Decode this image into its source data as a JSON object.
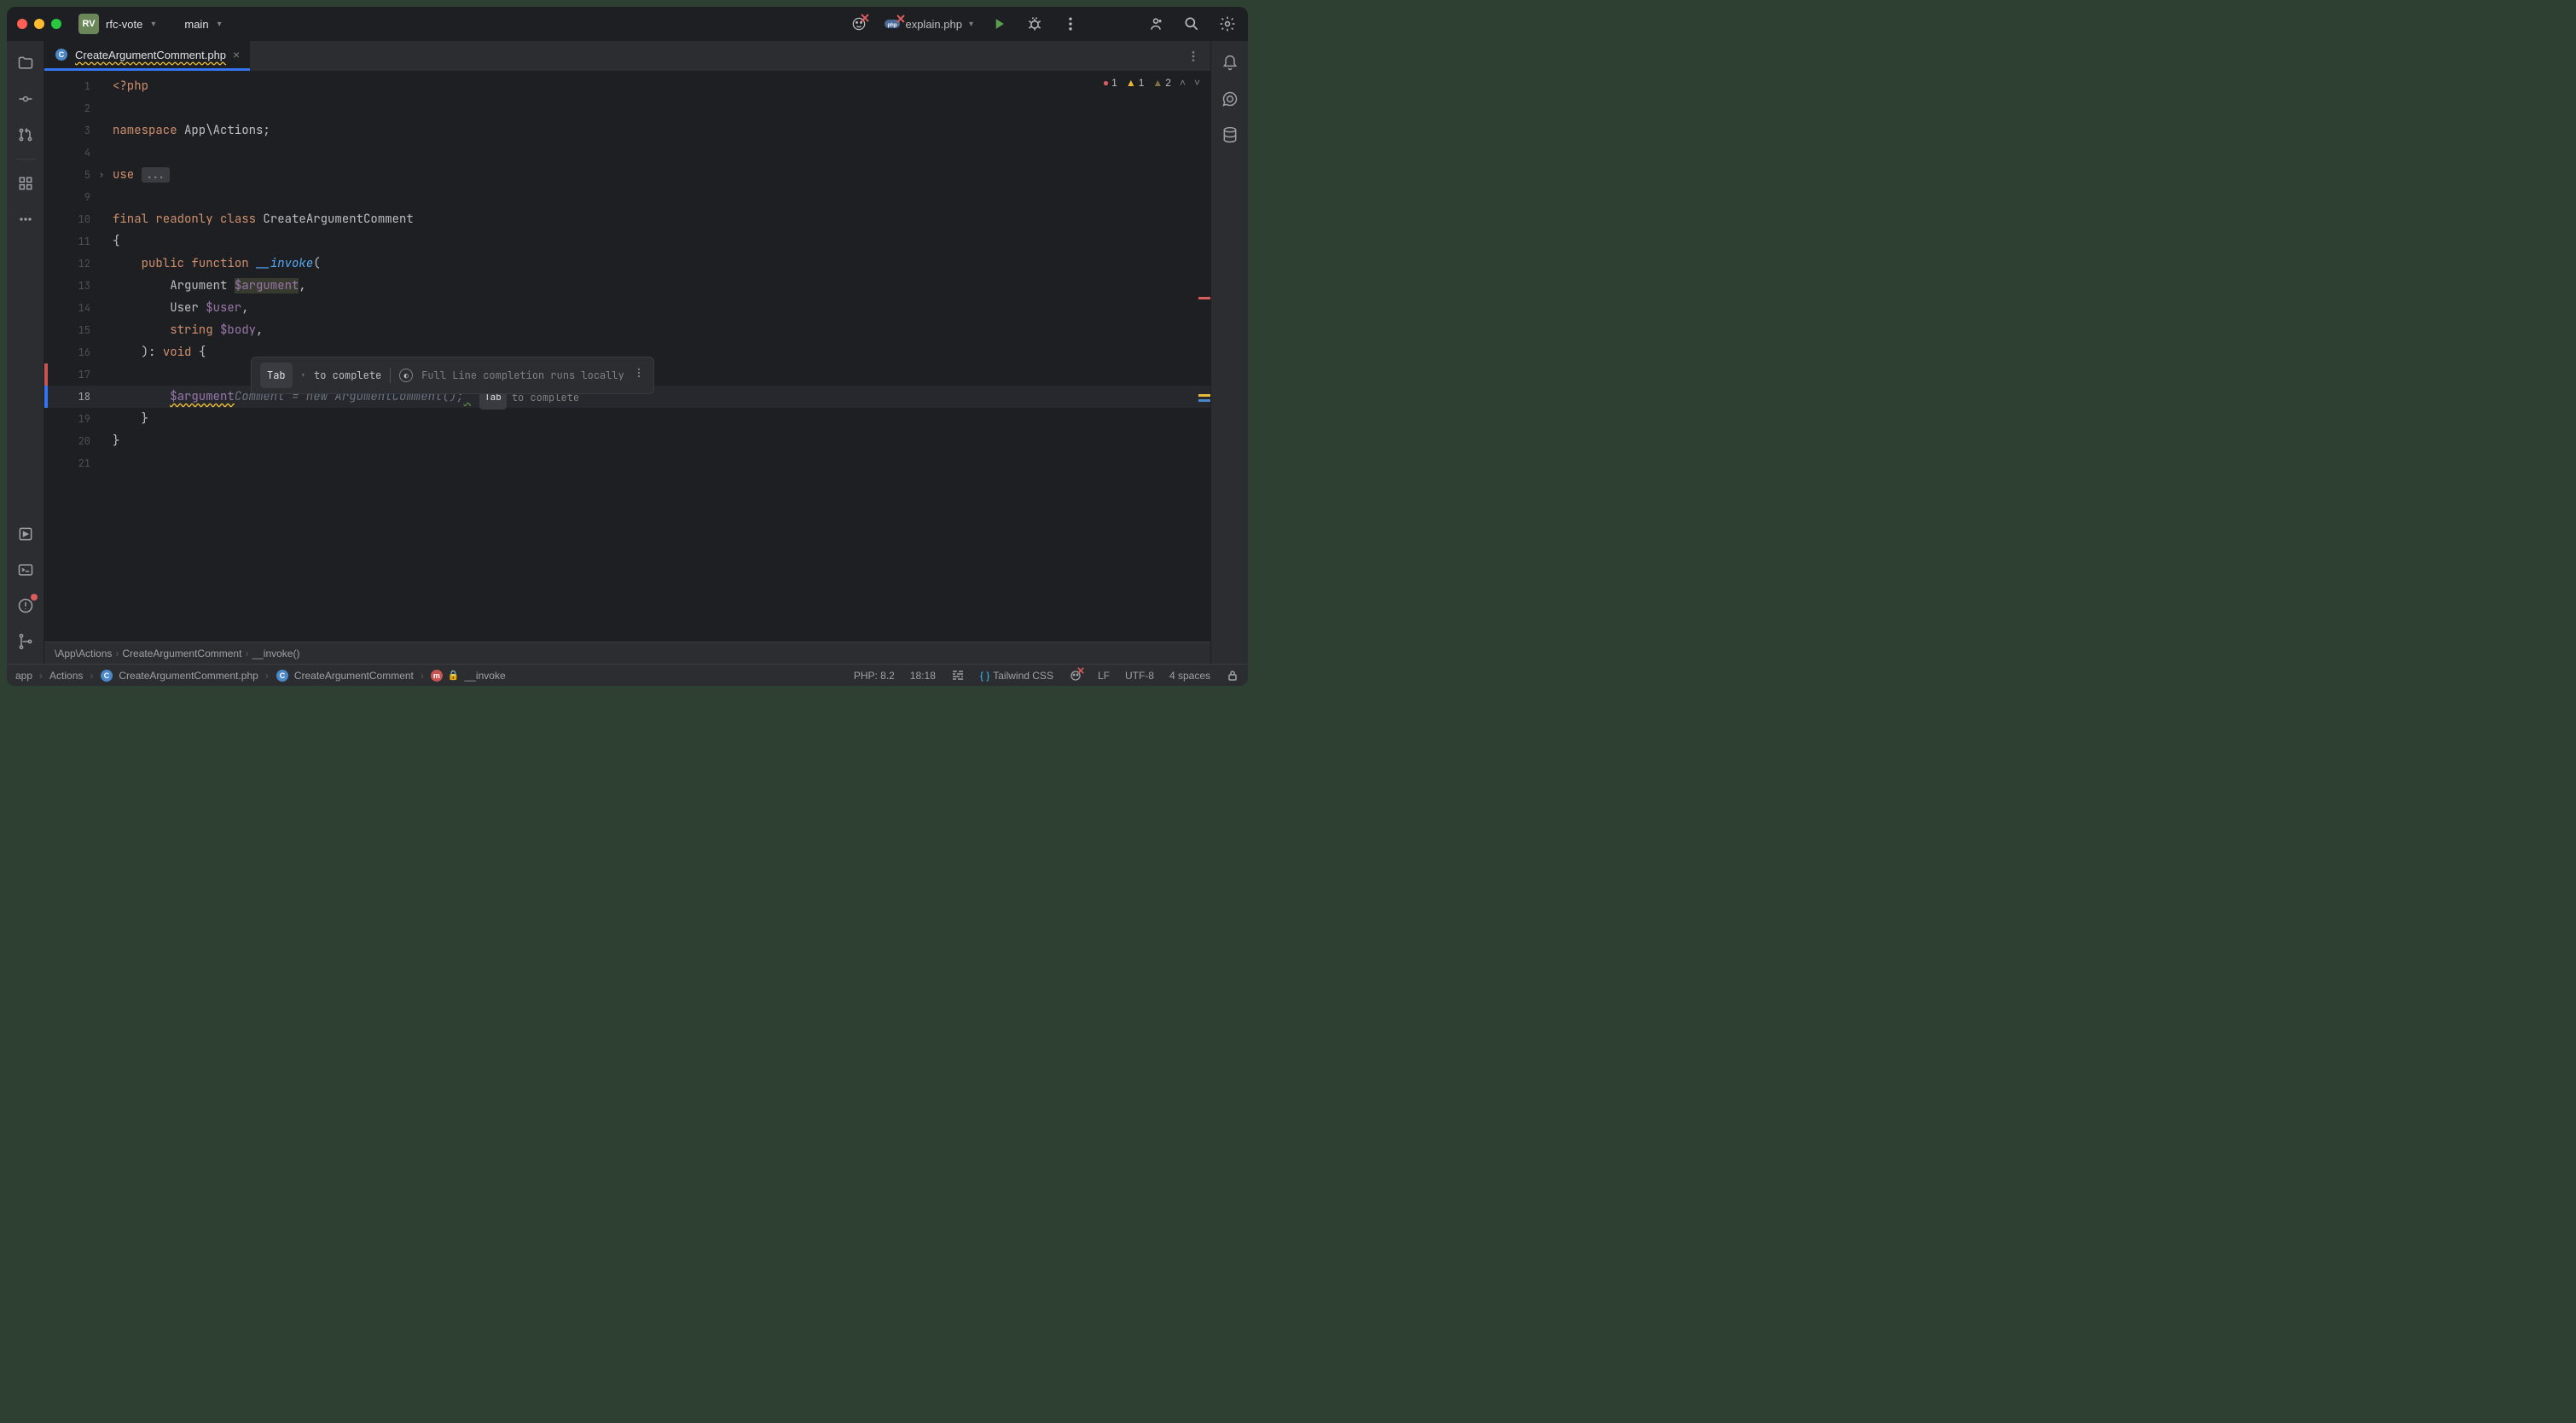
{
  "titlebar": {
    "avatar_initials": "RV",
    "project_name": "rfc-vote",
    "branch_name": "main",
    "run_config": "explain.php"
  },
  "tabs": {
    "active": {
      "label": "CreateArgumentComment.php"
    }
  },
  "inspections": {
    "errors": "1",
    "warnings": "1",
    "weak_warnings": "2"
  },
  "code": {
    "lines": [
      {
        "n": "1"
      },
      {
        "n": "2"
      },
      {
        "n": "3"
      },
      {
        "n": "4"
      },
      {
        "n": "5"
      },
      {
        "n": "9"
      },
      {
        "n": "10"
      },
      {
        "n": "11"
      },
      {
        "n": "12"
      },
      {
        "n": "13"
      },
      {
        "n": "14"
      },
      {
        "n": "15"
      },
      {
        "n": "16"
      },
      {
        "n": "17"
      },
      {
        "n": "18"
      },
      {
        "n": "19"
      },
      {
        "n": "20"
      },
      {
        "n": "21"
      }
    ],
    "l1_php": "<?php",
    "l3_ns_kw": "namespace ",
    "l3_ns": "App\\Actions",
    "l5_use": "use ",
    "l5_fold": "...",
    "l10_final": "final ",
    "l10_readonly": "readonly ",
    "l10_class": "class ",
    "l10_name": "CreateArgumentComment",
    "l11_brace": "{",
    "l12_public": "public ",
    "l12_function": "function ",
    "l12_name": "__invoke",
    "l12_paren": "(",
    "l13_type": "Argument ",
    "l13_var": "$argument",
    "l14_type": "User ",
    "l14_var": "$user",
    "l15_type": "string ",
    "l15_var": "$body",
    "l16_close": "): ",
    "l16_void": "void",
    "l16_brace": " {",
    "l18_typed": "$argument",
    "l18_suggest": "Comment = new ArgumentComment();",
    "l19_brace": "}",
    "l20_brace": "}"
  },
  "completion_popup": {
    "tab_label": "Tab",
    "to_complete": "to complete",
    "local_msg": "Full Line completion runs locally"
  },
  "inline_hint": {
    "tab_label": "Tab",
    "to_complete": "to complete"
  },
  "nav": {
    "seg1": "\\App\\Actions",
    "seg2": "CreateArgumentComment",
    "seg3": "__invoke()"
  },
  "breadcrumb": {
    "seg1": "app",
    "seg2": "Actions",
    "seg3": "CreateArgumentComment.php",
    "seg4": "CreateArgumentComment",
    "seg5": "__invoke"
  },
  "status": {
    "php_ver": "PHP: 8.2",
    "cursor": "18:18",
    "tailwind": "Tailwind CSS",
    "line_sep": "LF",
    "encoding": "UTF-8",
    "indent": "4 spaces"
  }
}
